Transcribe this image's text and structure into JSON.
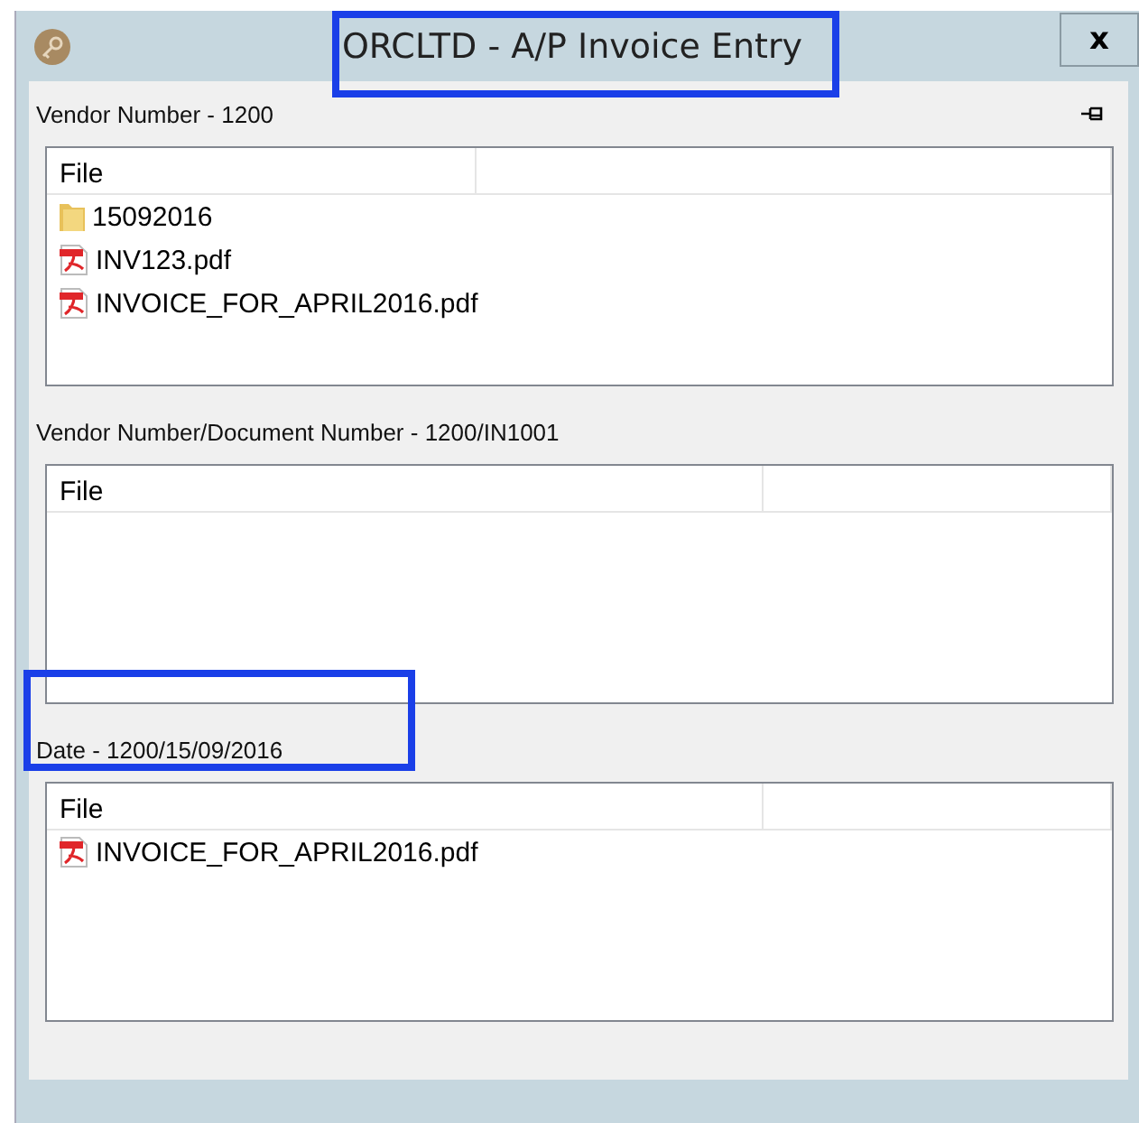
{
  "window": {
    "title": "ORCLTD - A/P Invoice Entry",
    "close": "x"
  },
  "sections": [
    {
      "label": "Vendor Number - 1200",
      "pinned": true,
      "columns": [
        "File",
        ""
      ],
      "files": [
        {
          "kind": "folder",
          "name": "15092016"
        },
        {
          "kind": "pdf",
          "name": "INV123.pdf"
        },
        {
          "kind": "pdf",
          "name": "INVOICE_FOR_APRIL2016.pdf"
        }
      ]
    },
    {
      "label": "Vendor Number/Document Number - 1200/IN1001",
      "pinned": false,
      "columns": [
        "File",
        ""
      ]
    },
    {
      "label": "Date - 1200/15/09/2016",
      "pinned": false,
      "columns": [
        "File",
        ""
      ],
      "files": [
        {
          "kind": "pdf",
          "name": "INVOICE_FOR_APRIL2016.pdf"
        }
      ]
    }
  ]
}
